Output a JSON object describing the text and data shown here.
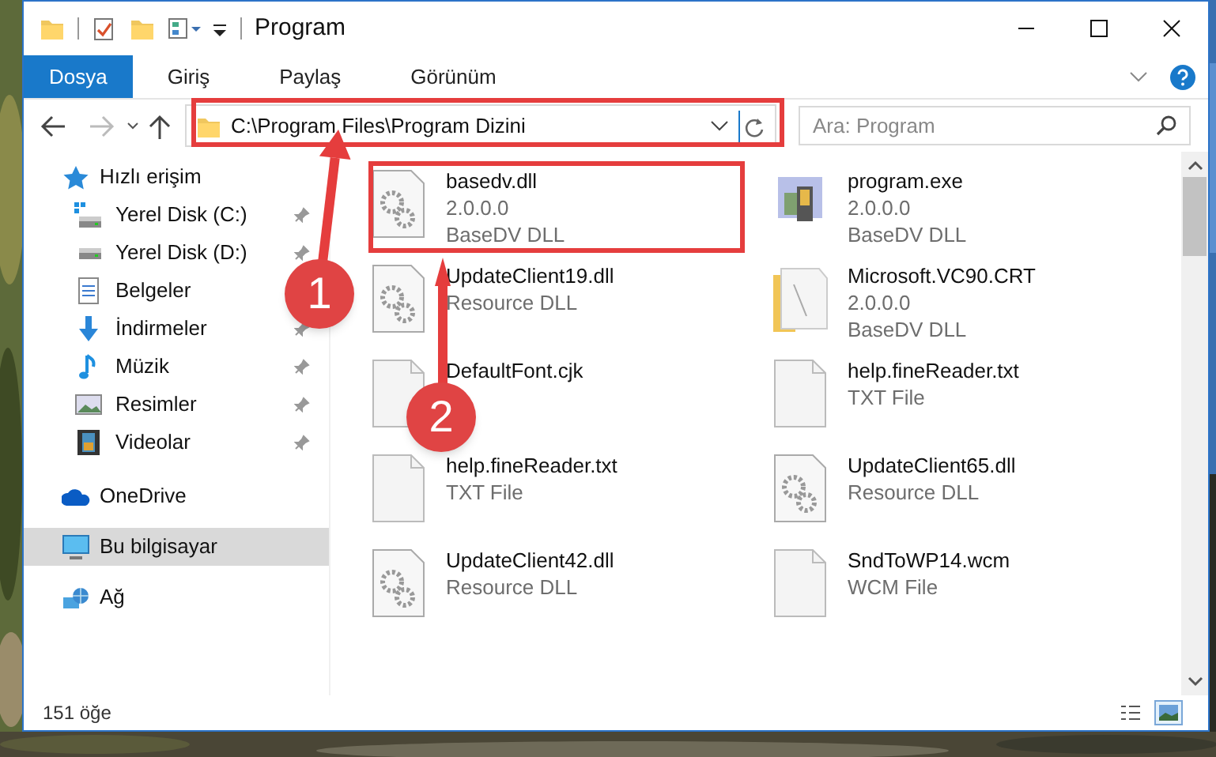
{
  "window": {
    "title": "Program"
  },
  "ribbon_tabs": [
    {
      "label": "Dosya",
      "kind": "file"
    },
    {
      "label": "Giriş",
      "kind": "tab"
    },
    {
      "label": "Paylaş",
      "kind": "tab"
    },
    {
      "label": "Görünüm",
      "kind": "tab"
    }
  ],
  "address": {
    "value": "C:\\Program Files\\Program Dizini"
  },
  "search": {
    "placeholder": "Ara: Program"
  },
  "sidebar": {
    "items": [
      {
        "label": "Hızlı erişim",
        "kind": "star",
        "selected": false,
        "children": [
          {
            "label": "Yerel Disk (C:)",
            "kind": "drive-c",
            "pinned": true
          },
          {
            "label": "Yerel Disk (D:)",
            "kind": "drive",
            "pinned": true
          },
          {
            "label": "Belgeler",
            "kind": "docs",
            "pinned": false
          },
          {
            "label": "İndirmeler",
            "kind": "download",
            "pinned": true
          },
          {
            "label": "Müzik",
            "kind": "music",
            "pinned": true
          },
          {
            "label": "Resimler",
            "kind": "pictures",
            "pinned": true
          },
          {
            "label": "Videolar",
            "kind": "videos",
            "pinned": true
          }
        ]
      },
      {
        "label": "OneDrive",
        "kind": "cloud",
        "selected": false
      },
      {
        "label": "Bu bilgisayar",
        "kind": "pc",
        "selected": true
      },
      {
        "label": "Ağ",
        "kind": "network",
        "selected": false
      }
    ]
  },
  "files": [
    {
      "name": "basedv.dll",
      "lines": [
        "2.0.0.0",
        "BaseDV DLL"
      ],
      "kind": "dll"
    },
    {
      "name": "program.exe",
      "lines": [
        "2.0.0.0",
        "BaseDV DLL"
      ],
      "kind": "exe"
    },
    {
      "name": "UpdateClient19.dll",
      "lines": [
        "Resource DLL"
      ],
      "kind": "dll"
    },
    {
      "name": "Microsoft.VC90.CRT",
      "lines": [
        "2.0.0.0",
        "BaseDV DLL"
      ],
      "kind": "folder"
    },
    {
      "name": "DefaultFont.cjk",
      "kind": "blank"
    },
    {
      "name": "help.fineReader.txt",
      "lines": [
        "TXT File"
      ],
      "kind": "blank"
    },
    {
      "name": "help.fineReader.txt",
      "lines": [
        "TXT File"
      ],
      "kind": "blank"
    },
    {
      "name": "UpdateClient65.dll",
      "lines": [
        "Resource DLL"
      ],
      "kind": "dll"
    },
    {
      "name": "UpdateClient42.dll",
      "lines": [
        "Resource DLL"
      ],
      "kind": "dll"
    },
    {
      "name": "SndToWP14.wcm",
      "lines": [
        "WCM File"
      ],
      "kind": "blank"
    }
  ],
  "status_bar": {
    "count": "151 öğe",
    "views": [
      {
        "kind": "details",
        "selected": false
      },
      {
        "kind": "large-icons",
        "selected": true
      }
    ]
  },
  "annotations": [
    {
      "label": "1"
    },
    {
      "label": "2"
    }
  ]
}
